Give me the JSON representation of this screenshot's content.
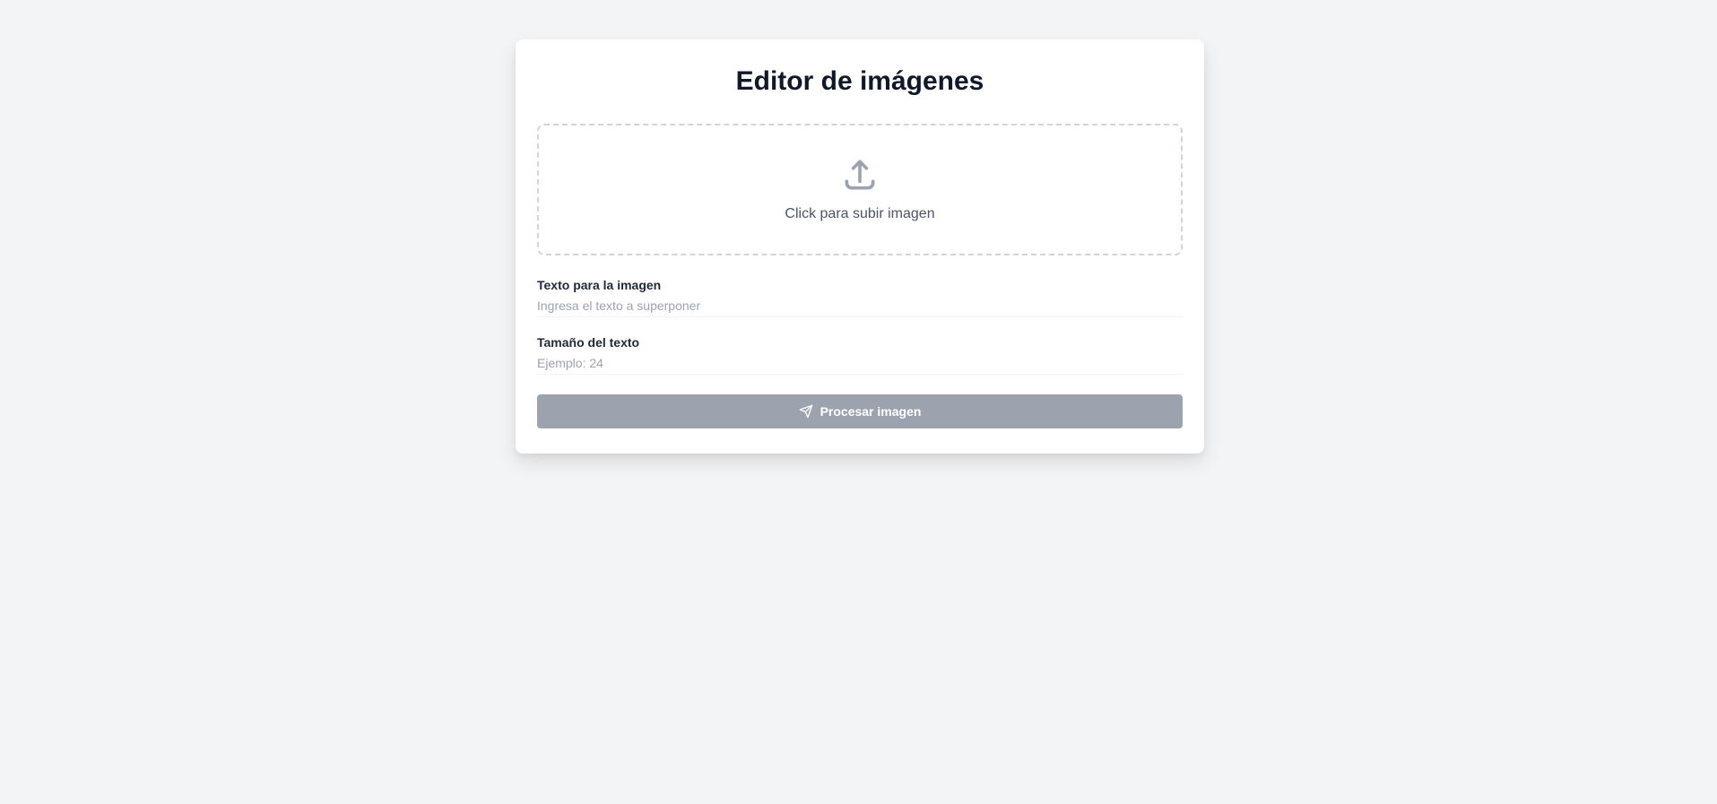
{
  "page": {
    "title": "Editor de imágenes"
  },
  "upload": {
    "label": "Click para subir imagen",
    "icon": "upload-icon"
  },
  "fields": {
    "text": {
      "label": "Texto para la imagen",
      "placeholder": "Ingresa el texto a superponer",
      "value": ""
    },
    "size": {
      "label": "Tamaño del texto",
      "placeholder": "Ejemplo: 24",
      "value": ""
    }
  },
  "submit": {
    "label": "Procesar imagen",
    "icon": "send-icon",
    "disabled": true
  },
  "colors": {
    "background": "#f3f4f6",
    "card": "#ffffff",
    "title": "#111827",
    "button_disabled": "#9ca3af",
    "dropzone_border": "#d1d5db"
  }
}
